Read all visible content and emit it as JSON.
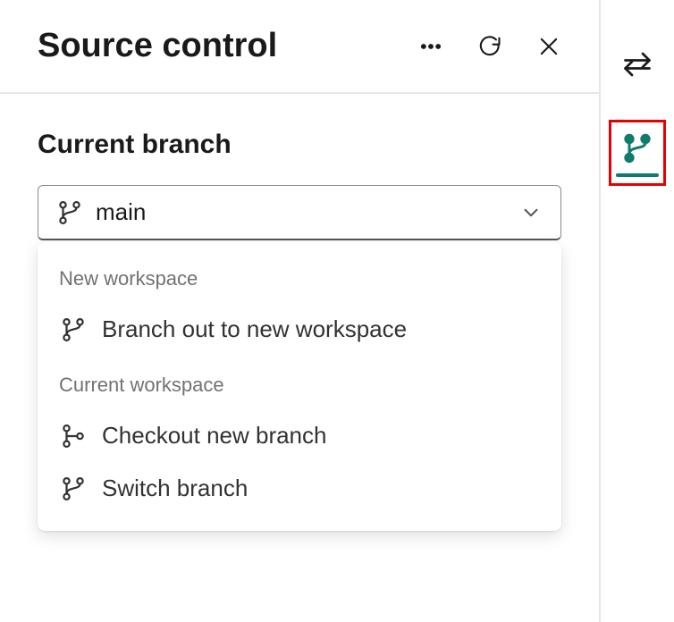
{
  "header": {
    "title": "Source control"
  },
  "section": {
    "label": "Current branch"
  },
  "dropdown": {
    "value": "main"
  },
  "menu": {
    "group1_label": "New workspace",
    "group1_items": [
      {
        "label": "Branch out to new workspace"
      }
    ],
    "group2_label": "Current workspace",
    "group2_items": [
      {
        "label": "Checkout new branch"
      },
      {
        "label": "Switch branch"
      }
    ]
  },
  "colors": {
    "accent": "#0f7b6c",
    "highlight_border": "#e60000"
  }
}
